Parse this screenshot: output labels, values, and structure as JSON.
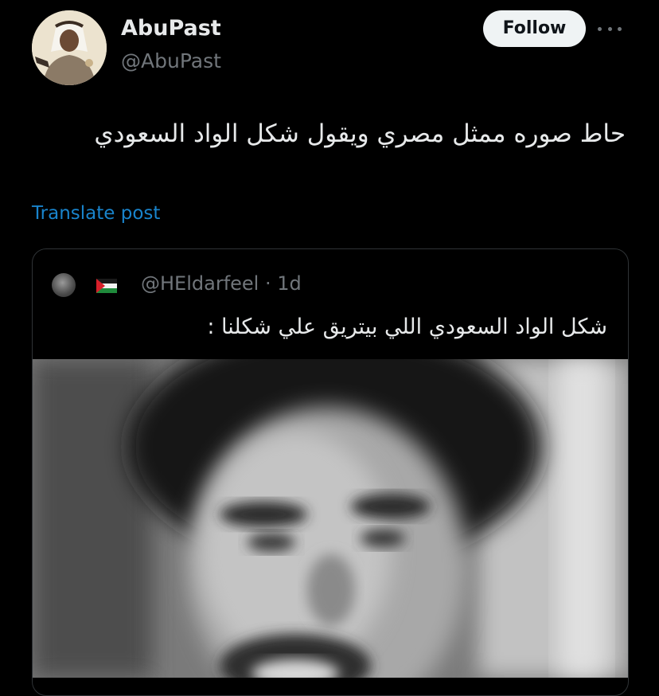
{
  "author": {
    "display_name": "AbuPast",
    "handle": "@AbuPast",
    "avatar": "profile-photo"
  },
  "actions": {
    "follow_label": "Follow",
    "more_icon": "more-dots-icon"
  },
  "tweet": {
    "text": "حاط صوره ممثل مصري ويقول شكل الواد السعودي",
    "translate_label": "Translate post"
  },
  "quote": {
    "avatar": "profile-photo",
    "flag_icon": "palestine-flag-icon",
    "handle_time": "@HEldarfeel · 1d",
    "text": "شكل الواد السعودي اللي بيتريق علي شكلنا :",
    "media": "blurred-face-photo"
  },
  "colors": {
    "background": "#000000",
    "text_primary": "#e7e9ea",
    "text_secondary": "#71767b",
    "link": "#1d9bf0",
    "follow_bg": "#eff3f4",
    "border": "#2f3336"
  }
}
